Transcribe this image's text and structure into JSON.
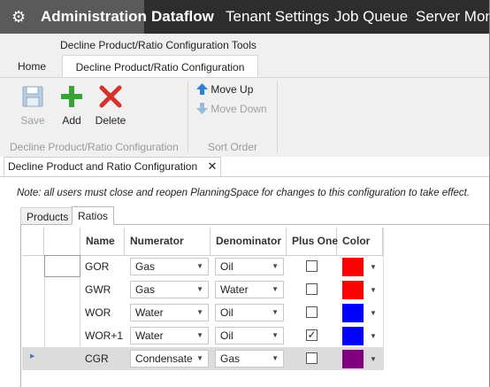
{
  "topnav": {
    "items": [
      "Administration",
      "Dataflow",
      "Tenant Settings",
      "Job Queue",
      "Server Mon"
    ]
  },
  "context_title": "Decline Product/Ratio Configuration Tools",
  "ribbon_tabs": [
    "Home",
    "Decline Product/Ratio Configuration"
  ],
  "ribbon": {
    "save": "Save",
    "add": "Add",
    "delete": "Delete",
    "group1": "Decline Product/Ratio Configuration",
    "move_up": "Move Up",
    "move_down": "Move Down",
    "group2": "Sort Order"
  },
  "doc_tab": {
    "label": "Decline Product and Ratio Configuration",
    "close": "✕"
  },
  "note": "Note: all users must close and reopen PlanningSpace for changes to this configuration to take effect.",
  "sub_tabs": [
    "Products",
    "Ratios"
  ],
  "grid": {
    "headers": [
      "Name",
      "Numerator",
      "Denominator",
      "Plus One",
      "Color"
    ],
    "rows": [
      {
        "name": "GOR",
        "numerator": "Gas",
        "denominator": "Oil",
        "plus_one": false,
        "color": "#ff0000"
      },
      {
        "name": "GWR",
        "numerator": "Gas",
        "denominator": "Water",
        "plus_one": false,
        "color": "#ff0000"
      },
      {
        "name": "WOR",
        "numerator": "Water",
        "denominator": "Oil",
        "plus_one": false,
        "color": "#0000ff"
      },
      {
        "name": "WOR+1",
        "numerator": "Water",
        "denominator": "Oil",
        "plus_one": true,
        "color": "#0000ff"
      },
      {
        "name": "CGR",
        "numerator": "Condensate",
        "denominator": "Gas",
        "plus_one": false,
        "color": "#800080"
      }
    ]
  },
  "colors": {
    "nav_bg": "#2d2d2d",
    "nav_active": "#5a5a5a",
    "add_green": "#3aa335",
    "delete_red": "#d9302c",
    "arrow_blue": "#2f7fd6"
  }
}
